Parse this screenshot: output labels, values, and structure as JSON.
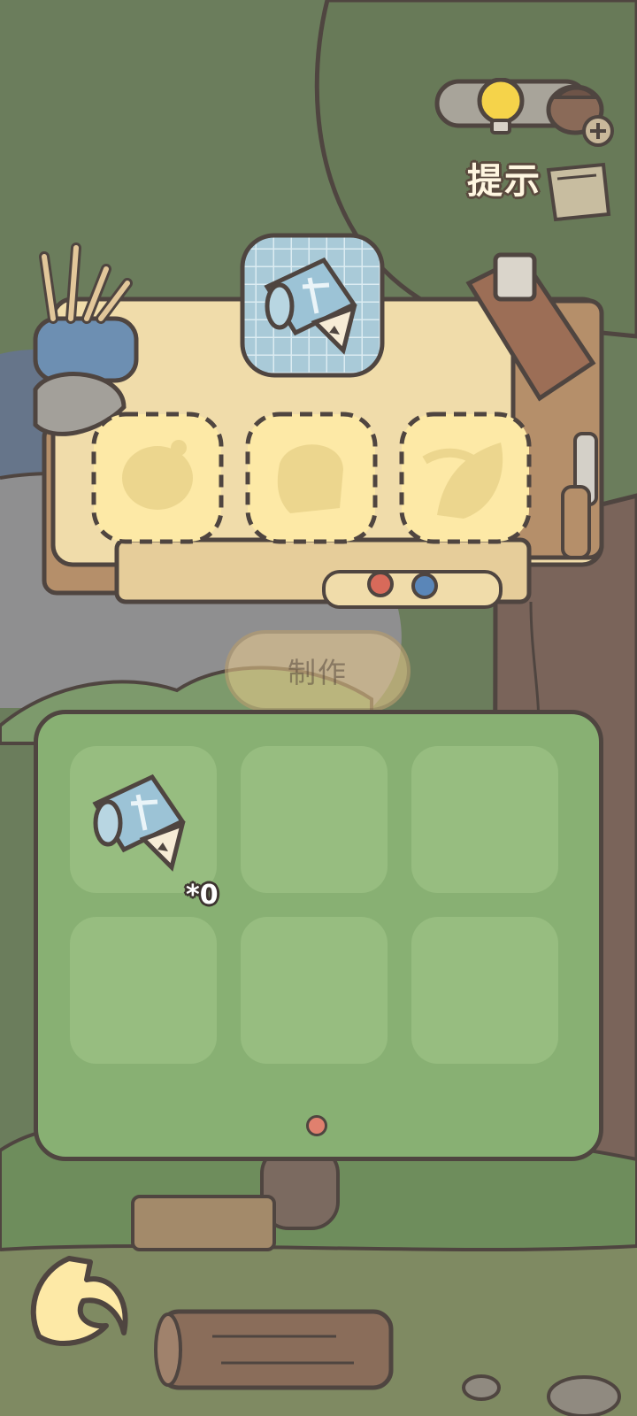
{
  "hint": {
    "label": "提示",
    "bulb_icon": "lightbulb-icon",
    "acorn_icon": "acorn-icon",
    "add_icon": "plus-icon"
  },
  "workbench": {
    "recipe_icon": "blueprint-scroll-icon",
    "slots": [
      {
        "icon": "sack-silhouette-icon"
      },
      {
        "icon": "bread-silhouette-icon"
      },
      {
        "icon": "leaf-pod-silhouette-icon"
      }
    ]
  },
  "craft_button": {
    "label": "制作"
  },
  "inventory": {
    "items": [
      {
        "icon": "blueprint-scroll-icon",
        "count": "*0"
      }
    ]
  },
  "navigation": {
    "back_icon": "back-arrow-icon"
  },
  "colors": {
    "background": "#6b7d5c",
    "panel": "#88b073",
    "slot": "#97bd80",
    "table": "#f0dcaa",
    "slot_empty": "#fde9a6",
    "outline": "#4f4540"
  }
}
